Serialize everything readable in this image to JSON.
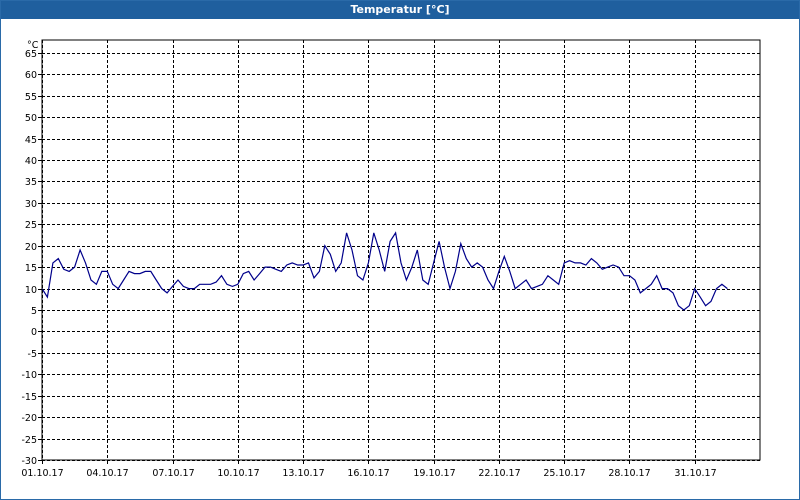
{
  "window": {
    "title": "Temperatur [°C]"
  },
  "chart_data": {
    "type": "line",
    "title": "Temperatur [°C]",
    "ylabel": "°C",
    "xlabel": "",
    "ylim": [
      -30,
      68
    ],
    "xlim_days": [
      0,
      33
    ],
    "y_ticks": [
      -30,
      -25,
      -20,
      -15,
      -10,
      -5,
      0,
      5,
      10,
      15,
      20,
      25,
      30,
      35,
      40,
      45,
      50,
      55,
      60,
      65
    ],
    "x_ticks": [
      "01.10.17",
      "04.10.17",
      "07.10.17",
      "10.10.17",
      "13.10.17",
      "16.10.17",
      "19.10.17",
      "22.10.17",
      "25.10.17",
      "28.10.17",
      "31.10.17"
    ],
    "grid": true,
    "line_color": "#00008b",
    "x_dates": [
      "01.10.17 00:00",
      "01.10.17 06:00",
      "01.10.17 12:00",
      "01.10.17 18:00",
      "02.10.17 00:00",
      "02.10.17 06:00",
      "02.10.17 12:00",
      "02.10.17 18:00",
      "03.10.17 00:00",
      "03.10.17 06:00",
      "03.10.17 12:00",
      "03.10.17 18:00",
      "04.10.17 00:00",
      "04.10.17 06:00",
      "04.10.17 12:00",
      "04.10.17 18:00",
      "05.10.17 00:00",
      "05.10.17 06:00",
      "05.10.17 12:00",
      "05.10.17 18:00",
      "06.10.17 00:00",
      "06.10.17 06:00",
      "06.10.17 12:00",
      "06.10.17 18:00",
      "07.10.17 00:00",
      "07.10.17 06:00",
      "07.10.17 12:00",
      "07.10.17 18:00",
      "08.10.17 00:00",
      "08.10.17 06:00",
      "08.10.17 12:00",
      "08.10.17 18:00",
      "09.10.17 00:00",
      "09.10.17 06:00",
      "09.10.17 12:00",
      "09.10.17 18:00",
      "10.10.17 00:00",
      "10.10.17 06:00",
      "10.10.17 12:00",
      "10.10.17 18:00",
      "11.10.17 00:00",
      "11.10.17 06:00",
      "11.10.17 12:00",
      "11.10.17 18:00",
      "12.10.17 00:00",
      "12.10.17 06:00",
      "12.10.17 12:00",
      "12.10.17 18:00",
      "13.10.17 00:00",
      "13.10.17 06:00",
      "13.10.17 12:00",
      "13.10.17 18:00",
      "14.10.17 00:00",
      "14.10.17 06:00",
      "14.10.17 12:00",
      "14.10.17 18:00",
      "15.10.17 00:00",
      "15.10.17 06:00",
      "15.10.17 12:00",
      "15.10.17 18:00",
      "16.10.17 00:00",
      "16.10.17 06:00",
      "16.10.17 12:00",
      "16.10.17 18:00",
      "17.10.17 00:00",
      "17.10.17 06:00",
      "17.10.17 12:00",
      "17.10.17 18:00",
      "18.10.17 00:00",
      "18.10.17 06:00",
      "18.10.17 12:00",
      "18.10.17 18:00",
      "19.10.17 00:00",
      "19.10.17 06:00",
      "19.10.17 12:00",
      "19.10.17 18:00",
      "20.10.17 00:00",
      "20.10.17 06:00",
      "20.10.17 12:00",
      "20.10.17 18:00",
      "21.10.17 00:00",
      "21.10.17 06:00",
      "21.10.17 12:00",
      "21.10.17 18:00",
      "22.10.17 00:00",
      "22.10.17 06:00",
      "22.10.17 12:00",
      "22.10.17 18:00",
      "23.10.17 00:00",
      "23.10.17 06:00",
      "23.10.17 12:00",
      "23.10.17 18:00",
      "24.10.17 00:00",
      "24.10.17 06:00",
      "24.10.17 12:00",
      "24.10.17 18:00",
      "25.10.17 00:00",
      "25.10.17 06:00",
      "25.10.17 12:00",
      "25.10.17 18:00",
      "26.10.17 00:00",
      "26.10.17 06:00",
      "26.10.17 12:00",
      "26.10.17 18:00",
      "27.10.17 00:00",
      "27.10.17 06:00",
      "27.10.17 12:00",
      "27.10.17 18:00",
      "28.10.17 00:00",
      "28.10.17 06:00",
      "28.10.17 12:00",
      "28.10.17 18:00",
      "29.10.17 00:00",
      "29.10.17 06:00",
      "29.10.17 12:00",
      "29.10.17 18:00",
      "30.10.17 00:00",
      "30.10.17 06:00",
      "30.10.17 12:00",
      "30.10.17 18:00",
      "31.10.17 00:00",
      "31.10.17 06:00",
      "31.10.17 12:00",
      "31.10.17 18:00",
      "01.11.17 00:00",
      "01.11.17 06:00",
      "01.11.17 12:00"
    ],
    "y": [
      10,
      8,
      16,
      17,
      14.5,
      14,
      15,
      19,
      16,
      12,
      11,
      14,
      14,
      11,
      10,
      12,
      14,
      13.5,
      13.5,
      14,
      14,
      12,
      10,
      9,
      10.5,
      12,
      10.5,
      10,
      10,
      11,
      11,
      11,
      11.5,
      13,
      11,
      10.5,
      11,
      13.5,
      14,
      12,
      13.5,
      15,
      15,
      14.5,
      14,
      15.5,
      16,
      15.5,
      15.5,
      16,
      12.5,
      14,
      20,
      18,
      14,
      16,
      23,
      19,
      13,
      12,
      16,
      23,
      19,
      14,
      21,
      23,
      16,
      12,
      15,
      19,
      12,
      11,
      16,
      21,
      15,
      10,
      14,
      20.5,
      17,
      15,
      16,
      15,
      12,
      10,
      14,
      17.5,
      14,
      10,
      11,
      12,
      10,
      10.5,
      11,
      13,
      12,
      11,
      16,
      16.5,
      16,
      16,
      15.5,
      17,
      16,
      14.5,
      15,
      15.5,
      15,
      13,
      13,
      12,
      9,
      10,
      11,
      13,
      10,
      10,
      9,
      6,
      5,
      6,
      10,
      8,
      6,
      7,
      10,
      11,
      10
    ]
  }
}
